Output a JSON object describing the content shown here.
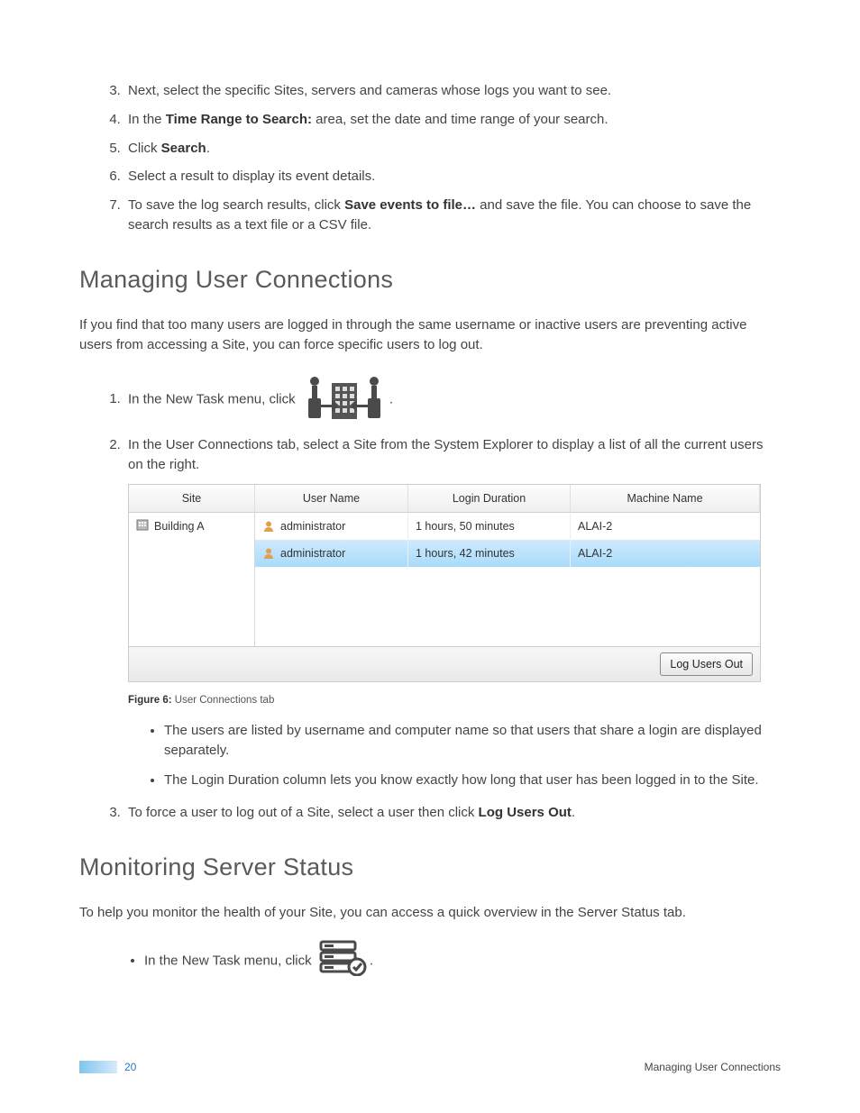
{
  "steps_top": [
    {
      "n": "3.",
      "pre": "Next, select the specific Sites, servers and cameras whose logs you want to see."
    },
    {
      "n": "4.",
      "pre": "In the ",
      "bold": "Time Range to Search:",
      "post": " area, set the date and time range of your search."
    },
    {
      "n": "5.",
      "pre": "Click ",
      "bold": "Search",
      "post": "."
    },
    {
      "n": "6.",
      "pre": "Select a result to display its event details."
    },
    {
      "n": "7.",
      "pre": "To save the log search results, click ",
      "bold": "Save events to file…",
      "post": " and save the file. You can choose to save the search results as a text file or a CSV file."
    }
  ],
  "sec1": {
    "heading": "Managing User Connections",
    "intro": "If you find that too many users are logged in through the same username or inactive users are preventing active users from accessing a Site, you can force specific users to log out.",
    "step1_pre": "In the New Task menu, click ",
    "step1_post": ".",
    "step2": "In the User Connections tab, select a Site from the System Explorer to display a list of all the current users on the right.",
    "figure": {
      "headers": {
        "site": "Site",
        "user": "User Name",
        "login": "Login Duration",
        "machine": "Machine Name"
      },
      "site_value": "Building A",
      "rows": [
        {
          "user": "administrator",
          "login": "1 hours, 50 minutes",
          "machine": "ALAI-2",
          "selected": false
        },
        {
          "user": "administrator",
          "login": "1 hours, 42 minutes",
          "machine": "ALAI-2",
          "selected": true
        }
      ],
      "button": "Log Users Out",
      "caption_bold": "Figure 6:",
      "caption_rest": " User Connections tab"
    },
    "bullets": [
      "The users are listed by username and computer name so that users that share a login are displayed separately.",
      "The Login Duration column lets you know exactly how long that user has been logged in to the Site."
    ],
    "step3_pre": "To force a user to log out of a Site, select a user then click ",
    "step3_bold": "Log Users Out",
    "step3_post": "."
  },
  "sec2": {
    "heading": "Monitoring Server Status",
    "intro": "To help you monitor the health of your Site, you can access a quick overview in the Server Status tab.",
    "bullet_pre": "In the New Task menu, click ",
    "bullet_post": "."
  },
  "footer": {
    "page_number": "20",
    "running_head": "Managing User Connections"
  }
}
